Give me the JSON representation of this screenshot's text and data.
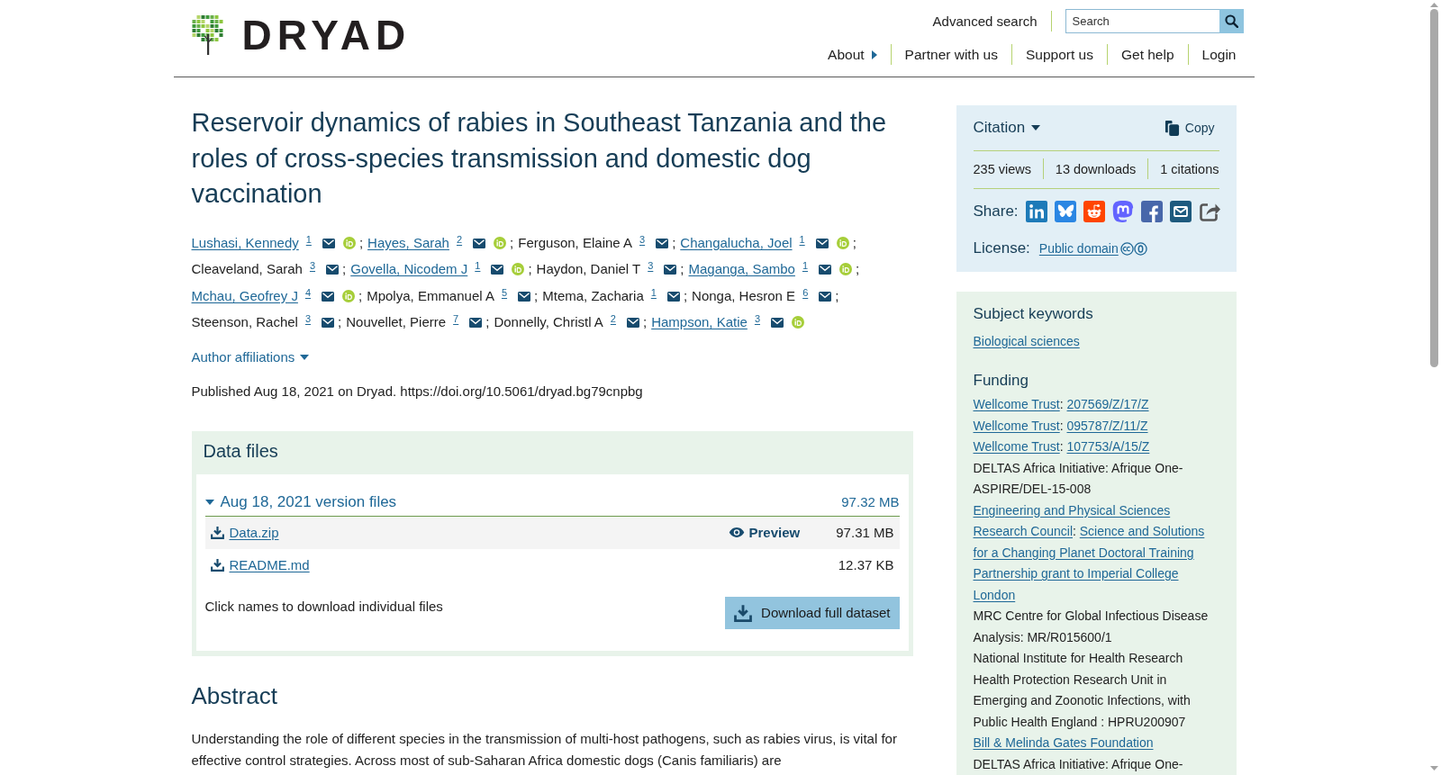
{
  "header": {
    "logo": "DRYAD",
    "advanced_search": "Advanced search",
    "search": {
      "placeholder": "Search"
    },
    "nav": [
      {
        "label": "About",
        "menu": true
      },
      {
        "label": "Partner with us",
        "menu": false
      },
      {
        "label": "Support us",
        "menu": false
      },
      {
        "label": "Get help",
        "menu": false
      },
      {
        "label": "Login",
        "menu": false
      }
    ]
  },
  "article": {
    "title": "Reservoir dynamics of rabies in Southeast Tanzania and the roles of cross-species transmission and domestic dog vaccination",
    "authors": [
      {
        "name": "Lushasi, Kennedy",
        "linked": true,
        "affiliation": "1",
        "email": true,
        "orcid": true,
        "separator": ";"
      },
      {
        "name": "Hayes, Sarah",
        "linked": true,
        "affiliation": "2",
        "email": true,
        "orcid": true,
        "separator": ";"
      },
      {
        "name": "Ferguson, Elaine A",
        "linked": false,
        "affiliation": "3",
        "email": true,
        "orcid": false,
        "separator": ";"
      },
      {
        "name": "Changalucha, Joel",
        "linked": true,
        "affiliation": "1",
        "email": true,
        "orcid": true,
        "separator": ";"
      },
      {
        "name": "Cleaveland, Sarah",
        "linked": false,
        "affiliation": "3",
        "email": true,
        "orcid": false,
        "separator": ";"
      },
      {
        "name": "Govella, Nicodem J",
        "linked": true,
        "affiliation": "1",
        "email": true,
        "orcid": true,
        "separator": ";"
      },
      {
        "name": "Haydon, Daniel T",
        "linked": false,
        "affiliation": "3",
        "email": true,
        "orcid": false,
        "separator": ";"
      },
      {
        "name": "Maganga, Sambo",
        "linked": true,
        "affiliation": "1",
        "email": true,
        "orcid": true,
        "separator": ";"
      },
      {
        "name": "Mchau, Geofrey J",
        "linked": true,
        "affiliation": "4",
        "email": true,
        "orcid": true,
        "separator": ";"
      },
      {
        "name": "Mpolya, Emmanuel A",
        "linked": false,
        "affiliation": "5",
        "email": true,
        "orcid": false,
        "separator": ";"
      },
      {
        "name": "Mtema, Zacharia",
        "linked": false,
        "affiliation": "1",
        "email": true,
        "orcid": false,
        "separator": ";"
      },
      {
        "name": "Nonga, Hesron E",
        "linked": false,
        "affiliation": "6",
        "email": true,
        "orcid": false,
        "separator": ";"
      },
      {
        "name": "Steenson, Rachel",
        "linked": false,
        "affiliation": "3",
        "email": true,
        "orcid": false,
        "separator": ";"
      },
      {
        "name": "Nouvellet, Pierre",
        "linked": false,
        "affiliation": "7",
        "email": true,
        "orcid": false,
        "separator": ";"
      },
      {
        "name": "Donnelly, Christl A",
        "linked": false,
        "affiliation": "2",
        "email": true,
        "orcid": false,
        "separator": ";"
      },
      {
        "name": "Hampson, Katie",
        "linked": true,
        "affiliation": "3",
        "email": true,
        "orcid": true
      }
    ],
    "affiliations": {
      "label": "Author affiliations",
      "expanded": false
    },
    "published": "Published Aug 18, 2021 on Dryad. https://doi.org/10.5061/dryad.bg79cnpbg"
  },
  "data_files": {
    "title": "Data files",
    "versions": [
      {
        "label": "Aug 18, 2021 version files",
        "size": "97.32 MB",
        "expanded": true,
        "files": [
          {
            "name": "Data.zip",
            "preview": "Preview",
            "size": "97.31 MB"
          },
          {
            "name": "README.md",
            "size": "12.37 KB"
          }
        ]
      }
    ],
    "hint": "Click names to download individual files",
    "download_button": "Download full dataset"
  },
  "abstract": {
    "title": "Abstract",
    "text": "Understanding the role of different species in the transmission of multi-host pathogens, such as rabies virus, is vital for effective control strategies. Across most of sub-Saharan Africa domestic dogs (Canis familiaris) are"
  },
  "sidebar": {
    "citation": {
      "title": "Citation",
      "expanded": false,
      "copy": "Copy",
      "stats": [
        "235 views",
        "13 downloads",
        "1 citations"
      ],
      "share_label": "Share:",
      "license_label": "License:",
      "license": "Public domain"
    },
    "keywords": {
      "title": "Subject keywords",
      "items": [
        "Biological sciences"
      ]
    },
    "funding": {
      "title": "Funding",
      "entries": [
        {
          "parts": [
            {
              "text": "Wellcome Trust",
              "link": true
            },
            {
              "text": ":",
              "link": false
            },
            {
              "text": "207569/Z/17/Z",
              "link": true
            }
          ]
        },
        {
          "parts": [
            {
              "text": "Wellcome Trust",
              "link": true
            },
            {
              "text": ":",
              "link": false
            },
            {
              "text": "095787/Z/11/Z",
              "link": true
            }
          ]
        },
        {
          "parts": [
            {
              "text": "Wellcome Trust",
              "link": true
            },
            {
              "text": ":",
              "link": false
            },
            {
              "text": "107753/A/15/Z",
              "link": true
            }
          ]
        },
        {
          "parts": [
            {
              "text": "DELTAS Africa Initiative: Afrique One-ASPIRE/DEL-15-008",
              "link": false
            }
          ]
        },
        {
          "parts": [
            {
              "text": "Engineering and Physical Sciences Research Council",
              "link": true
            },
            {
              "text": ":",
              "link": false
            },
            {
              "text": "Science and Solutions for a Changing Planet Doctoral Training Partnership grant to Imperial College London",
              "link": true
            }
          ]
        },
        {
          "parts": [
            {
              "text": "MRC Centre for Global Infectious Disease Analysis: MR/R015600/1",
              "link": false
            }
          ]
        },
        {
          "parts": [
            {
              "text": "National Institute for Health Research Health Protection Research Unit in Emerging and Zoonotic Infections, with Public Health England : HPRU200907",
              "link": false
            }
          ]
        },
        {
          "parts": [
            {
              "text": "Bill & Melinda Gates Foundation",
              "link": true
            }
          ]
        },
        {
          "parts": [
            {
              "text": "DELTAS Africa Initiative: Afrique One-",
              "link": false
            }
          ]
        }
      ]
    }
  }
}
